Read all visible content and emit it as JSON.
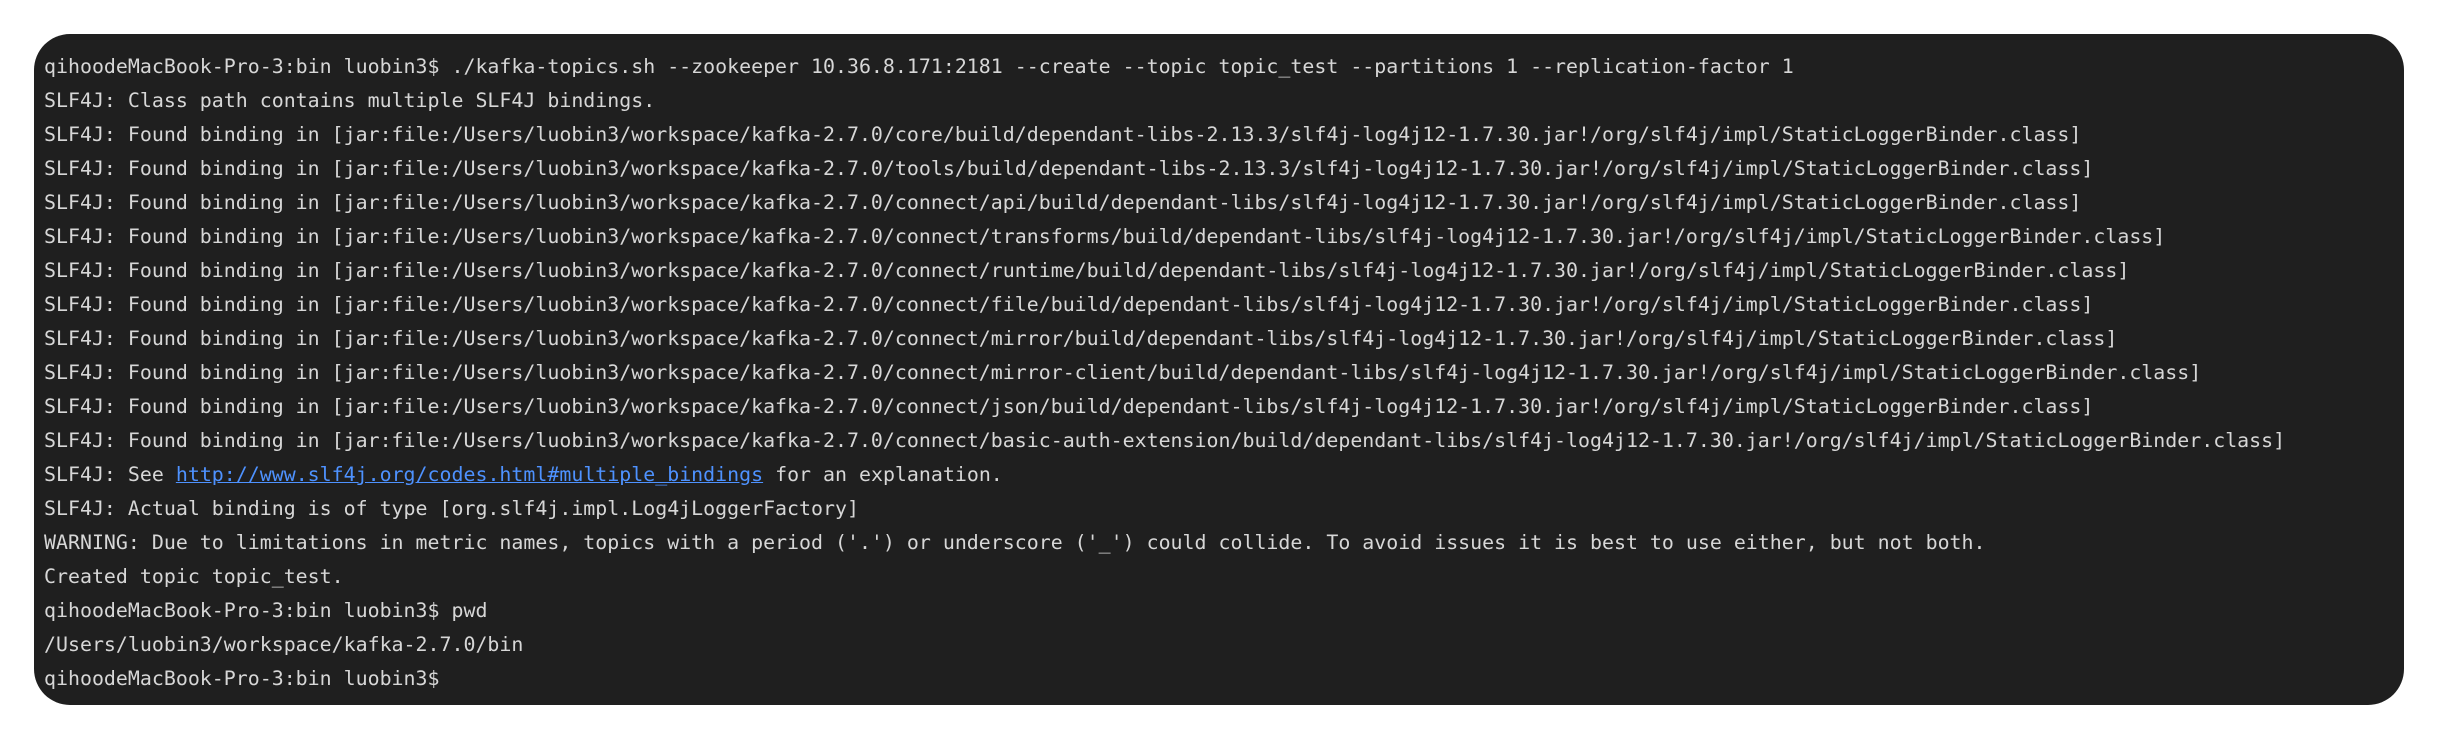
{
  "terminal": {
    "lines": [
      "qihoodeMacBook-Pro-3:bin luobin3$ ./kafka-topics.sh --zookeeper 10.36.8.171:2181 --create --topic topic_test --partitions 1 --replication-factor 1",
      "SLF4J: Class path contains multiple SLF4J bindings.",
      "SLF4J: Found binding in [jar:file:/Users/luobin3/workspace/kafka-2.7.0/core/build/dependant-libs-2.13.3/slf4j-log4j12-1.7.30.jar!/org/slf4j/impl/StaticLoggerBinder.class]",
      "SLF4J: Found binding in [jar:file:/Users/luobin3/workspace/kafka-2.7.0/tools/build/dependant-libs-2.13.3/slf4j-log4j12-1.7.30.jar!/org/slf4j/impl/StaticLoggerBinder.class]",
      "SLF4J: Found binding in [jar:file:/Users/luobin3/workspace/kafka-2.7.0/connect/api/build/dependant-libs/slf4j-log4j12-1.7.30.jar!/org/slf4j/impl/StaticLoggerBinder.class]",
      "SLF4J: Found binding in [jar:file:/Users/luobin3/workspace/kafka-2.7.0/connect/transforms/build/dependant-libs/slf4j-log4j12-1.7.30.jar!/org/slf4j/impl/StaticLoggerBinder.class]",
      "SLF4J: Found binding in [jar:file:/Users/luobin3/workspace/kafka-2.7.0/connect/runtime/build/dependant-libs/slf4j-log4j12-1.7.30.jar!/org/slf4j/impl/StaticLoggerBinder.class]",
      "SLF4J: Found binding in [jar:file:/Users/luobin3/workspace/kafka-2.7.0/connect/file/build/dependant-libs/slf4j-log4j12-1.7.30.jar!/org/slf4j/impl/StaticLoggerBinder.class]",
      "SLF4J: Found binding in [jar:file:/Users/luobin3/workspace/kafka-2.7.0/connect/mirror/build/dependant-libs/slf4j-log4j12-1.7.30.jar!/org/slf4j/impl/StaticLoggerBinder.class]",
      "SLF4J: Found binding in [jar:file:/Users/luobin3/workspace/kafka-2.7.0/connect/mirror-client/build/dependant-libs/slf4j-log4j12-1.7.30.jar!/org/slf4j/impl/StaticLoggerBinder.class]",
      "SLF4J: Found binding in [jar:file:/Users/luobin3/workspace/kafka-2.7.0/connect/json/build/dependant-libs/slf4j-log4j12-1.7.30.jar!/org/slf4j/impl/StaticLoggerBinder.class]",
      "SLF4J: Found binding in [jar:file:/Users/luobin3/workspace/kafka-2.7.0/connect/basic-auth-extension/build/dependant-libs/slf4j-log4j12-1.7.30.jar!/org/slf4j/impl/StaticLoggerBinder.class]"
    ],
    "see_line": {
      "prefix": "SLF4J: See ",
      "link": "http://www.slf4j.org/codes.html#multiple_bindings",
      "suffix": " for an explanation."
    },
    "lines_after": [
      "SLF4J: Actual binding is of type [org.slf4j.impl.Log4jLoggerFactory]",
      "WARNING: Due to limitations in metric names, topics with a period ('.') or underscore ('_') could collide. To avoid issues it is best to use either, but not both.",
      "Created topic topic_test.",
      "qihoodeMacBook-Pro-3:bin luobin3$ pwd",
      "/Users/luobin3/workspace/kafka-2.7.0/bin",
      "qihoodeMacBook-Pro-3:bin luobin3$"
    ],
    "colors": {
      "background": "#1f1f1f",
      "text": "#d7d7d7",
      "link": "#4e92ff"
    }
  }
}
